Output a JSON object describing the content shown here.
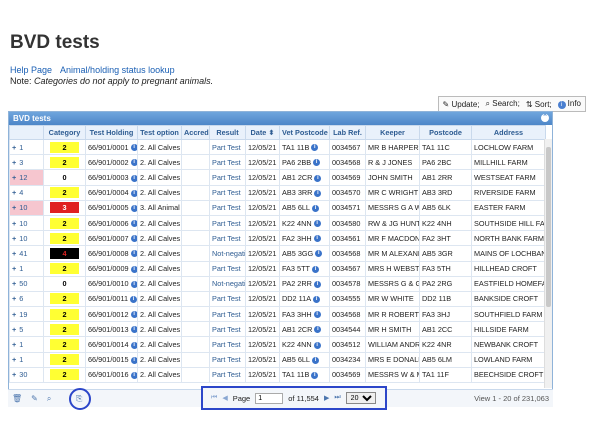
{
  "page": {
    "title": "BVD tests",
    "links": [
      "Help Page",
      "Animal/holding status lookup"
    ],
    "note_prefix": "Note: ",
    "note_text": "Categories do not apply to pregnant animals."
  },
  "toolbar": {
    "update_label": "Update;",
    "search_label": "Search;",
    "sort_label": "Sort;",
    "info_label": "Info"
  },
  "grid": {
    "caption": "BVD tests",
    "columns": [
      "",
      "Category",
      "Test Holding",
      "Test option",
      "Accred",
      "Result",
      "Date",
      "Vet Postcode",
      "Lab Ref.",
      "Keeper",
      "Postcode",
      "Address"
    ],
    "rows": [
      {
        "num": "1",
        "cat": "2",
        "cat_color": "#ffff33",
        "cat_text": "#000",
        "holding": "66/901/0001",
        "option": "2. All Calves",
        "accred": "",
        "result": "Part Test",
        "date": "12/05/21",
        "vet": "TA1 11B",
        "lab": "0034567",
        "keeper": "MR B HARPER",
        "postcode": "TA1 11C",
        "address": "LOCHLOW FARM",
        "hl": false
      },
      {
        "num": "3",
        "cat": "2",
        "cat_color": "#ffff33",
        "cat_text": "#000",
        "holding": "66/901/0002",
        "option": "2. All Calves",
        "accred": "",
        "result": "Part Test",
        "date": "12/05/21",
        "vet": "PA6 2BB",
        "lab": "0034568",
        "keeper": "R & J JONES",
        "postcode": "PA6 2BC",
        "address": "MILLHILL FARM",
        "hl": false
      },
      {
        "num": "12",
        "cat": "0",
        "cat_color": "#ffffff",
        "cat_text": "#000",
        "holding": "66/901/0003",
        "option": "2. All Calves",
        "accred": "",
        "result": "Part Test",
        "date": "12/05/21",
        "vet": "AB1 2CR",
        "lab": "0034569",
        "keeper": "JOHN SMITH",
        "postcode": "AB1 2RR",
        "address": "WESTSEAT FARM",
        "hl": true
      },
      {
        "num": "4",
        "cat": "2",
        "cat_color": "#ffff33",
        "cat_text": "#000",
        "holding": "66/901/0004",
        "option": "2. All Calves",
        "accred": "",
        "result": "Part Test",
        "date": "12/05/21",
        "vet": "AB3 3RR",
        "lab": "0034570",
        "keeper": "MR C WRIGHT",
        "postcode": "AB3 3RD",
        "address": "RIVERSIDE FARM",
        "hl": false
      },
      {
        "num": "10",
        "cat": "3",
        "cat_color": "#e02020",
        "cat_text": "#fff",
        "holding": "66/901/0005",
        "option": "3. All Animal",
        "accred": "",
        "result": "Part Test",
        "date": "12/05/21",
        "vet": "AB5 6LL",
        "lab": "0034571",
        "keeper": "MESSRS G A W",
        "postcode": "AB5 6LK",
        "address": "EASTER FARM",
        "hl": true
      },
      {
        "num": "10",
        "cat": "2",
        "cat_color": "#ffff33",
        "cat_text": "#000",
        "holding": "66/901/0006",
        "option": "2. All Calves",
        "accred": "",
        "result": "Part Test",
        "date": "12/05/21",
        "vet": "K22 4NN",
        "lab": "0034580",
        "keeper": "RW & JG HUNT",
        "postcode": "K22 4NH",
        "address": "SOUTHSIDE HILL FAR",
        "hl": false
      },
      {
        "num": "10",
        "cat": "2",
        "cat_color": "#ffff33",
        "cat_text": "#000",
        "holding": "66/901/0007",
        "option": "2. All Calves",
        "accred": "",
        "result": "Part Test",
        "date": "12/05/21",
        "vet": "FA2 3HH",
        "lab": "0034561",
        "keeper": "MR F MACDON",
        "postcode": "FA2 3HT",
        "address": "NORTH BANK FARM",
        "hl": false
      },
      {
        "num": "41",
        "cat": "4",
        "cat_color": "#000000",
        "cat_text": "#d22",
        "holding": "66/901/0008",
        "option": "2. All Calves",
        "accred": "",
        "result": "Not-negati",
        "date": "12/05/21",
        "vet": "AB5 3GG",
        "lab": "0034568",
        "keeper": "MR M ALEXAND",
        "postcode": "AB5 3GR",
        "address": "MAINS OF LOCHBAN",
        "hl": false
      },
      {
        "num": "1",
        "cat": "2",
        "cat_color": "#ffff33",
        "cat_text": "#000",
        "holding": "66/901/0009",
        "option": "2. All Calves",
        "accred": "",
        "result": "Part Test",
        "date": "12/05/21",
        "vet": "FA3 5TT",
        "lab": "0034567",
        "keeper": "MRS H WEBSTE",
        "postcode": "FA3 5TH",
        "address": "HILLHEAD CROFT",
        "hl": false
      },
      {
        "num": "50",
        "cat": "0",
        "cat_color": "#ffffff",
        "cat_text": "#000",
        "holding": "66/901/0010",
        "option": "2. All Calves",
        "accred": "",
        "result": "Not-negati",
        "date": "12/05/21",
        "vet": "PA2 2RR",
        "lab": "0034578",
        "keeper": "MESSRS G & G",
        "postcode": "PA2 2RG",
        "address": "EASTFIELD HOMEFAR",
        "hl": false
      },
      {
        "num": "6",
        "cat": "2",
        "cat_color": "#ffff33",
        "cat_text": "#000",
        "holding": "66/901/0011",
        "option": "2. All Calves",
        "accred": "",
        "result": "Part Test",
        "date": "12/05/21",
        "vet": "DD2 11A",
        "lab": "0034555",
        "keeper": "MR W WHITE",
        "postcode": "DD2 11B",
        "address": "BANKSIDE CROFT",
        "hl": false
      },
      {
        "num": "19",
        "cat": "2",
        "cat_color": "#ffff33",
        "cat_text": "#000",
        "holding": "66/901/0012",
        "option": "2. All Calves",
        "accred": "",
        "result": "Part Test",
        "date": "12/05/21",
        "vet": "FA3 3HH",
        "lab": "0034568",
        "keeper": "MR R ROBERTS",
        "postcode": "FA3 3HJ",
        "address": "SOUTHFIELD FARM",
        "hl": false
      },
      {
        "num": "5",
        "cat": "2",
        "cat_color": "#ffff33",
        "cat_text": "#000",
        "holding": "66/901/0013",
        "option": "2. All Calves",
        "accred": "",
        "result": "Part Test",
        "date": "12/05/21",
        "vet": "AB1 2CR",
        "lab": "0034544",
        "keeper": "MR H SMITH",
        "postcode": "AB1 2CC",
        "address": "HILLSIDE FARM",
        "hl": false
      },
      {
        "num": "1",
        "cat": "2",
        "cat_color": "#ffff33",
        "cat_text": "#000",
        "holding": "66/901/0014",
        "option": "2. All Calves",
        "accred": "",
        "result": "Part Test",
        "date": "12/05/21",
        "vet": "K22 4NN",
        "lab": "0034512",
        "keeper": "WILLIAM ANDR",
        "postcode": "K22 4NR",
        "address": "NEWBANK CROFT",
        "hl": false
      },
      {
        "num": "1",
        "cat": "2",
        "cat_color": "#ffff33",
        "cat_text": "#000",
        "holding": "66/901/0015",
        "option": "2. All Calves",
        "accred": "",
        "result": "Part Test",
        "date": "12/05/21",
        "vet": "AB5 6LL",
        "lab": "0034234",
        "keeper": "MRS E DONALD",
        "postcode": "AB5 6LM",
        "address": "LOWLAND FARM",
        "hl": false
      },
      {
        "num": "30",
        "cat": "2",
        "cat_color": "#ffff33",
        "cat_text": "#000",
        "holding": "66/901/0016",
        "option": "2. All Calves",
        "accred": "",
        "result": "Part Test",
        "date": "12/05/21",
        "vet": "TA1 11B",
        "lab": "0034569",
        "keeper": "MESSRS W & M",
        "postcode": "TA1 11F",
        "address": "BEECHSIDE CROFT",
        "hl": false
      }
    ]
  },
  "pager": {
    "page_label": "Page",
    "page_value": "1",
    "of_label": "of 11,554",
    "page_size": "20",
    "view_text": "View 1 - 20 of 231,063"
  }
}
